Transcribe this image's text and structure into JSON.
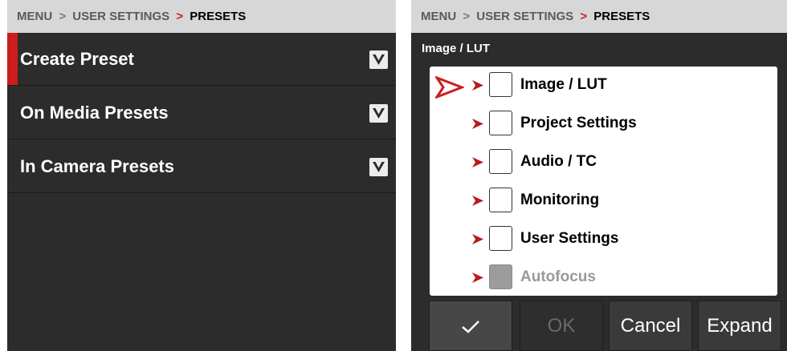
{
  "left_panel": {
    "breadcrumb": {
      "menu": "MENU",
      "sep1": ">",
      "section": "USER SETTINGS",
      "sep2": ">",
      "current": "PRESETS"
    },
    "menu_items": [
      {
        "label": "Create Preset",
        "selected": true
      },
      {
        "label": "On Media Presets",
        "selected": false
      },
      {
        "label": "In Camera Presets",
        "selected": false
      }
    ]
  },
  "right_panel": {
    "breadcrumb": {
      "menu": "MENU",
      "sep1": ">",
      "section": "USER SETTINGS",
      "sep2": ">",
      "current": "PRESETS"
    },
    "section_title": "Image / LUT",
    "list": [
      {
        "label": "Image / LUT",
        "checked": false,
        "enabled": true,
        "focused": true
      },
      {
        "label": "Project Settings",
        "checked": false,
        "enabled": true
      },
      {
        "label": "Audio / TC",
        "checked": false,
        "enabled": true
      },
      {
        "label": "Monitoring",
        "checked": false,
        "enabled": true
      },
      {
        "label": "User Settings",
        "checked": false,
        "enabled": true
      },
      {
        "label": "Autofocus",
        "checked": false,
        "enabled": false
      }
    ],
    "buttons": {
      "check_icon": "checkmark-icon",
      "ok": "OK",
      "cancel": "Cancel",
      "expand": "Expand"
    }
  },
  "colors": {
    "accent": "#cc1e1e",
    "panel_bg": "#2c2c2c",
    "breadcrumb_bg": "#d7d7d7"
  }
}
